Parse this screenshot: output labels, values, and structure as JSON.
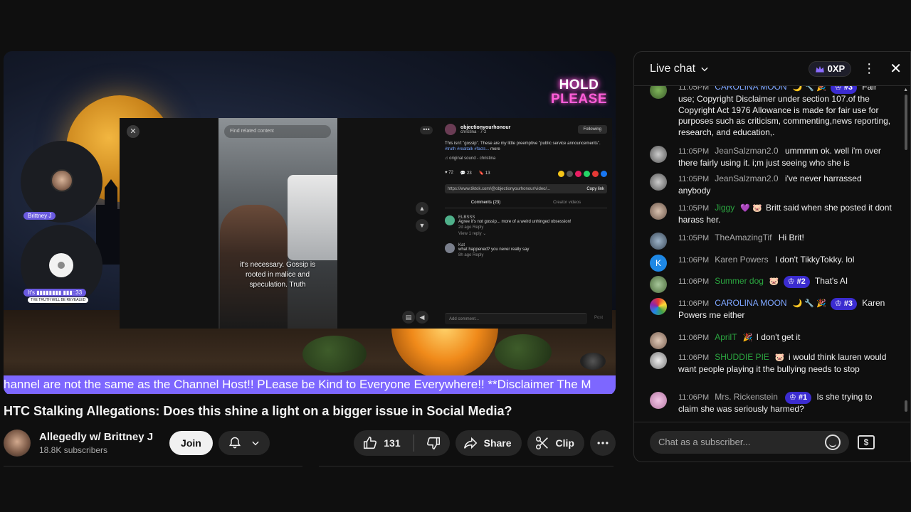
{
  "video": {
    "overlay_text_line1": "HOLD",
    "overlay_text_line2": "PLEASE",
    "cam1_tag": "Brittney J",
    "cam2_tag": "It's ▮▮▮▮▮▮▮▮ ▮▮▮::33",
    "cam2_sub": "THE TRUTH WILL BE REVEALED",
    "ticker": "hannel are not the same as the Channel Host!! PLease be Kind to Everyone Everywhere!! **Disclaimer The M",
    "tiktok": {
      "close": "✕",
      "search_placeholder": "Find related content",
      "caption": "it's necessary. Gossip is rooted in malice and speculation. Truth",
      "more": "•••",
      "username": "objectionyourhonour",
      "handle": "christina · 7-2",
      "follow": "Following",
      "desc": "This isn't \"gossip\". These are my little preemptive \"public service announcements\".",
      "desc_tags": "#truth #realtalk #facts...",
      "desc_more": "more",
      "sound": "♫ original sound - christina",
      "likes": "♥ 72",
      "comments_count": "💬 23",
      "saves": "🔖 13",
      "link": "https://www.tiktok.com/@objectionyourhonour/video/...",
      "copy_link": "Copy link",
      "tab_comments": "Comments (23)",
      "tab_creator": "Creator videos",
      "comment1_user": "ELBSSS",
      "comment1_text": "Agree it's not gossip... more of a weird unhinged obsession!",
      "comment1_meta": "2d ago   Reply",
      "comment1_replies": "View 1 reply ⌄",
      "comment2_user": "Kat",
      "comment2_text": "what happened? you never really say",
      "comment2_meta": "8h ago   Reply",
      "add_comment": "Add comment...",
      "post": "Post"
    }
  },
  "title": "HTC Stalking Allegations: Does this shine a light on a bigger issue in Social Media?",
  "channel": {
    "name": "Allegedly w/ Brittney J",
    "subscribers": "18.8K subscribers",
    "join": "Join"
  },
  "actions": {
    "likes": "131",
    "share": "Share",
    "clip": "Clip"
  },
  "chat": {
    "title": "Live chat",
    "xp": "0XP",
    "input_placeholder": "Chat as a subscriber...",
    "messages": [
      {
        "time": "11:05PM",
        "author": "CAROLINA MOON",
        "emoji": "🌙 🔧 🎉",
        "badge": "#3",
        "text": "Fair use; Copyright Disclaimer under section 107.of the Copyright Act 1976 Allowance is made for fair use for purposes such as criticism, commenting,news reporting, research, and education,."
      },
      {
        "time": "11:05PM",
        "author": "JeanSalzman2.0",
        "emoji": "",
        "badge": "",
        "text": "ummmm ok. well i'm over there fairly using it. i;m just seeing who she is"
      },
      {
        "time": "11:05PM",
        "author": "JeanSalzman2.0",
        "emoji": "",
        "badge": "",
        "text": "i've never harrassed anybody"
      },
      {
        "time": "11:05PM",
        "author": "Jiggy",
        "emoji": "💜 🐷",
        "badge": "",
        "text": "Britt said when she posted it dont harass her."
      },
      {
        "time": "11:05PM",
        "author": "TheAmazingTif",
        "emoji": "",
        "badge": "",
        "text": "Hi Brit!"
      },
      {
        "time": "11:06PM",
        "author": "Karen Powers",
        "emoji": "",
        "badge": "",
        "text": "I don't TikkyTokky. lol"
      },
      {
        "time": "11:06PM",
        "author": "Summer dog",
        "emoji": "🐷",
        "badge": "#2",
        "text": "That's AI"
      },
      {
        "time": "11:06PM",
        "author": "CAROLINA MOON",
        "emoji": "🌙 🔧 🎉",
        "badge": "#3",
        "text": "Karen Powers me either"
      },
      {
        "time": "11:06PM",
        "author": "AprilT",
        "emoji": "🎉",
        "badge": "",
        "text": "I don't get it"
      },
      {
        "time": "11:06PM",
        "author": "SHUDDIE PIE",
        "emoji": "🐷",
        "badge": "",
        "text": "i would think lauren would want people playing it the bullying needs to stop"
      },
      {
        "time": "11:06PM",
        "author": "Mrs. Rickenstein",
        "emoji": "",
        "badge": "#1",
        "text": "Is she trying to claim she was seriously harmed?"
      }
    ]
  },
  "colors": {
    "accent_purple": "#7d67ff",
    "badge_blue": "#3b2cd0",
    "author_member_blue": "#7ea6ff",
    "author_green": "#2ba640"
  }
}
